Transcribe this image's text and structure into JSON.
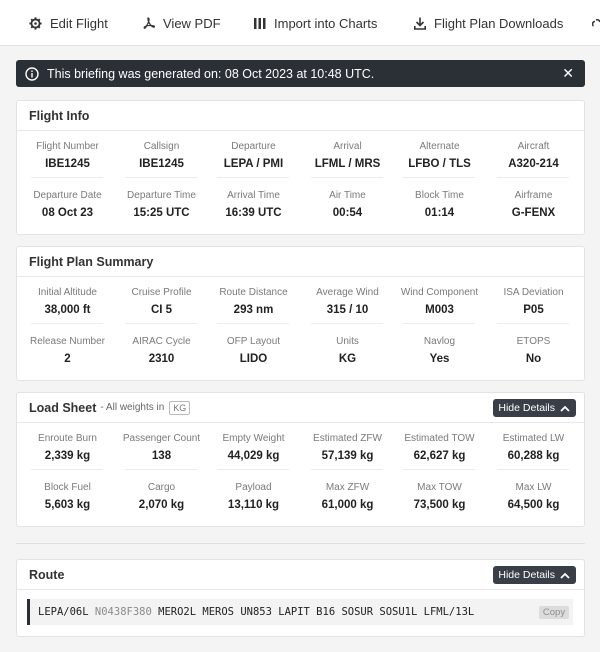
{
  "toolbar": {
    "edit_label": "Edit Flight",
    "pdf_label": "View PDF",
    "import_label": "Import into Charts",
    "download_label": "Flight Plan Downloads"
  },
  "alert": {
    "message": "This briefing was generated on: 08 Oct 2023 at 10:48 UTC."
  },
  "flight_info": {
    "title": "Flight Info",
    "fields": [
      {
        "label": "Flight Number",
        "value": "IBE1245"
      },
      {
        "label": "Callsign",
        "value": "IBE1245"
      },
      {
        "label": "Departure",
        "value": "LEPA / PMI"
      },
      {
        "label": "Arrival",
        "value": "LFML / MRS"
      },
      {
        "label": "Alternate",
        "value": "LFBO / TLS"
      },
      {
        "label": "Aircraft",
        "value": "A320-214"
      },
      {
        "label": "Departure Date",
        "value": "08 Oct 23"
      },
      {
        "label": "Departure Time",
        "value": "15:25 UTC"
      },
      {
        "label": "Arrival Time",
        "value": "16:39 UTC"
      },
      {
        "label": "Air Time",
        "value": "00:54"
      },
      {
        "label": "Block Time",
        "value": "01:14"
      },
      {
        "label": "Airframe",
        "value": "G-FENX"
      }
    ]
  },
  "plan_summary": {
    "title": "Flight Plan Summary",
    "fields": [
      {
        "label": "Initial Altitude",
        "value": "38,000 ft"
      },
      {
        "label": "Cruise Profile",
        "value": "CI 5"
      },
      {
        "label": "Route Distance",
        "value": "293 nm"
      },
      {
        "label": "Average Wind",
        "value": "315 / 10"
      },
      {
        "label": "Wind Component",
        "value": "M003"
      },
      {
        "label": "ISA Deviation",
        "value": "P05"
      },
      {
        "label": "Release Number",
        "value": "2"
      },
      {
        "label": "AIRAC Cycle",
        "value": "2310"
      },
      {
        "label": "OFP Layout",
        "value": "LIDO"
      },
      {
        "label": "Units",
        "value": "KG"
      },
      {
        "label": "Navlog",
        "value": "Yes"
      },
      {
        "label": "ETOPS",
        "value": "No"
      }
    ]
  },
  "load_sheet": {
    "title": "Load Sheet",
    "subtitle": "- All weights in",
    "unit_badge": "KG",
    "hide_label": "Hide Details",
    "fields": [
      {
        "label": "Enroute Burn",
        "value": "2,339 kg"
      },
      {
        "label": "Passenger Count",
        "value": "138"
      },
      {
        "label": "Empty Weight",
        "value": "44,029 kg"
      },
      {
        "label": "Estimated ZFW",
        "value": "57,139 kg"
      },
      {
        "label": "Estimated TOW",
        "value": "62,627 kg"
      },
      {
        "label": "Estimated LW",
        "value": "60,288 kg"
      },
      {
        "label": "Block Fuel",
        "value": "5,603 kg"
      },
      {
        "label": "Cargo",
        "value": "2,070 kg"
      },
      {
        "label": "Payload",
        "value": "13,110 kg"
      },
      {
        "label": "Max ZFW",
        "value": "61,000 kg"
      },
      {
        "label": "Max TOW",
        "value": "73,500 kg"
      },
      {
        "label": "Max LW",
        "value": "64,500 kg"
      }
    ]
  },
  "route": {
    "title": "Route",
    "hide_label": "Hide Details",
    "origin": "LEPA/06L",
    "speed_level": "N0438F380",
    "rest": "MERO2L MEROS UN853 LAPIT B16 SOSUR SOSU1L LFML/13L",
    "copy_label": "Copy"
  }
}
